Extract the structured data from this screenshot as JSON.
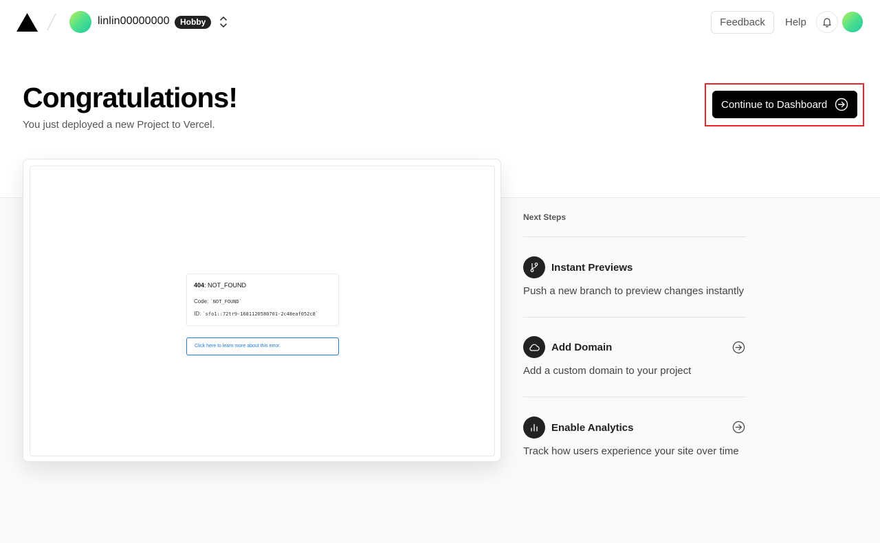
{
  "header": {
    "team_name": "linlin00000000",
    "plan_badge": "Hobby",
    "feedback_label": "Feedback",
    "help_label": "Help"
  },
  "hero": {
    "title": "Congratulations!",
    "subtitle": "You just deployed a new Project to Vercel.",
    "cta_label": "Continue to Dashboard"
  },
  "preview": {
    "error_status": "404",
    "error_name": ": NOT_FOUND",
    "code_label": "Code:",
    "code_value": "`NOT_FOUND`",
    "id_label": "ID:",
    "id_value": "`sfo1::72tr9-1681120580701-2c48eaf052c8`",
    "link_text": "Click here to learn more about this error."
  },
  "next_steps": {
    "title": "Next Steps",
    "items": [
      {
        "title": "Instant Previews",
        "description": "Push a new branch to preview changes instantly",
        "icon": "git-branch-icon"
      },
      {
        "title": "Add Domain",
        "description": "Add a custom domain to your project",
        "icon": "cloud-icon"
      },
      {
        "title": "Enable Analytics",
        "description": "Track how users experience your site over time",
        "icon": "bar-chart-icon"
      }
    ]
  },
  "colors": {
    "accent": "#000000",
    "highlight_border": "#e8262b",
    "link": "#1f7ae0",
    "badge_bg": "#222222"
  }
}
